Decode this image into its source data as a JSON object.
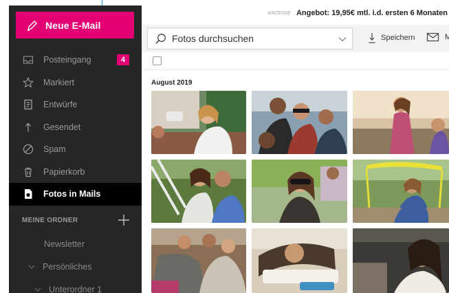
{
  "sidebar": {
    "compose_label": "Neue E-Mail",
    "items": [
      {
        "label": "Posteingang",
        "icon": "inbox-icon",
        "badge": "4"
      },
      {
        "label": "Markiert",
        "icon": "star-icon"
      },
      {
        "label": "Entwürfe",
        "icon": "drafts-icon"
      },
      {
        "label": "Gesendet",
        "icon": "sent-icon"
      },
      {
        "label": "Spam",
        "icon": "spam-icon"
      },
      {
        "label": "Papierkorb",
        "icon": "trash-icon"
      },
      {
        "label": "Fotos in Mails",
        "icon": "photos-icon",
        "active": true
      }
    ],
    "folders_heading": "MEINE ORDNER",
    "folders": [
      {
        "label": "Newsletter"
      },
      {
        "label": "Persönliches"
      },
      {
        "label": "Unterordner 1"
      }
    ]
  },
  "ad": {
    "tag": "ANZEIGE",
    "text": "Angebot: 19,95€ mtl. i.d. ersten 6 Monaten"
  },
  "toolbar": {
    "search_placeholder": "Fotos durchsuchen",
    "save_label": "Speichern",
    "mail_label": "M"
  },
  "gallery": {
    "month": "August 2019",
    "photo_count": 9
  },
  "colors": {
    "brand": "#e20074",
    "sidebar_bg": "#262626",
    "active_bg": "#000000",
    "callout": "#2a8ad4"
  }
}
